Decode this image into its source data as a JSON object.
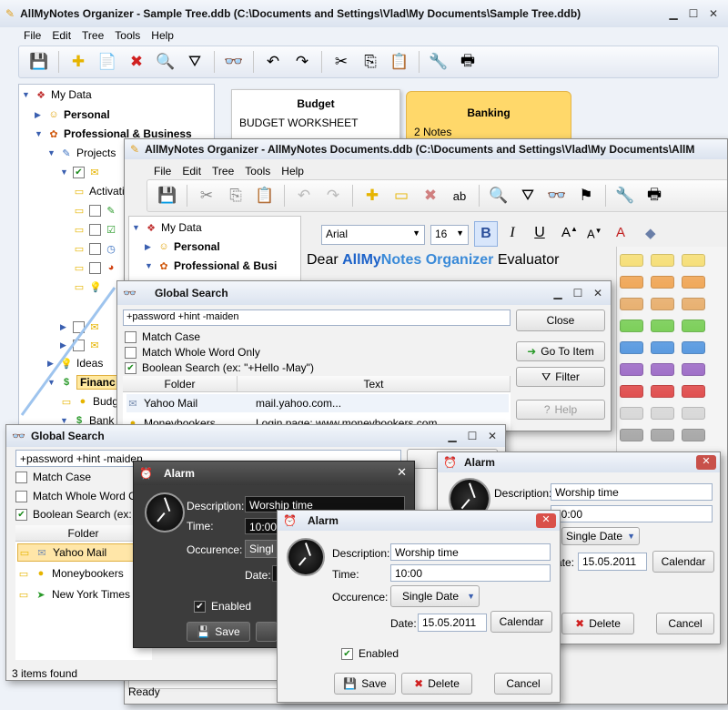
{
  "main": {
    "title": "AllMyNotes Organizer - Sample Tree.ddb (C:\\Documents and Settings\\Vlad\\My Documents\\Sample Tree.ddb)",
    "menu": [
      "File",
      "Edit",
      "Tree",
      "Tools",
      "Help"
    ],
    "tree": {
      "root": "My Data",
      "personal": "Personal",
      "professional": "Professional & Business",
      "projects": "Projects",
      "activation": "Activati",
      "ideas": "Ideas",
      "finance": "Financ",
      "budget": "Budg",
      "bank": "Bank"
    },
    "tabs": {
      "budget_title": "Budget",
      "budget_body": "BUDGET WORKSHEET",
      "banking_title": "Banking",
      "banking_body": "2 Notes"
    }
  },
  "second": {
    "title": "AllMyNotes Organizer - AllMyNotes Documents.ddb (C:\\Documents and Settings\\Vlad\\My Documents\\AllM",
    "menu": [
      "File",
      "Edit",
      "Tree",
      "Tools",
      "Help"
    ],
    "tree": {
      "root": "My Data",
      "personal": "Personal",
      "professional": "Professional & Busi"
    },
    "font": "Arial",
    "size": "16",
    "editor": {
      "part1": "Dear ",
      "part2": "AllMy",
      "part3": "Notes Organizer",
      "part4": " Evaluator"
    },
    "status": "Ready"
  },
  "search1": {
    "title": "Global Search",
    "query": "+password +hint -maiden",
    "match_case": "Match Case",
    "whole_word": "Match Whole Word Only",
    "boolean": "Boolean Search (ex: \"+Hello -May\")",
    "col_folder": "Folder",
    "col_text": "Text",
    "rows": [
      {
        "folder": "Yahoo Mail",
        "text": "mail.yahoo.com..."
      },
      {
        "folder": "Moneybookers",
        "text": "Login page: www.moneybookers.com..."
      }
    ],
    "close": "Close",
    "goto": "Go To Item",
    "filter": "Filter",
    "help": "Help"
  },
  "search2": {
    "title": "Global Search",
    "query": "+password +hint -maiden",
    "match_case": "Match Case",
    "whole_word": "Match Whole Word O",
    "boolean": "Boolean Search (ex: \"",
    "col_folder": "Folder",
    "rows": [
      "Yahoo Mail",
      "Moneybookers",
      "New York Times"
    ],
    "status": "3 items found"
  },
  "alarm_dark": {
    "title": "Alarm",
    "desc_label": "Description:",
    "desc": "Worship time",
    "time_label": "Time:",
    "time": "10:00",
    "occ_label": "Occurence:",
    "occ": "Singl",
    "date_label": "Date:",
    "date": "1",
    "enabled": "Enabled",
    "save": "Save"
  },
  "alarm_right": {
    "title": "Alarm",
    "desc_label": "Description:",
    "desc": "Worship time",
    "time": "10:00",
    "occ": "Single Date",
    "date_label": "ate:",
    "date": "15.05.2011",
    "calendar": "Calendar",
    "delete": "Delete",
    "cancel": "Cancel"
  },
  "alarm_front": {
    "title": "Alarm",
    "desc_label": "Description:",
    "desc": "Worship time",
    "time_label": "Time:",
    "time": "10:00",
    "occ_label": "Occurence:",
    "occ": "Single Date",
    "date_label": "Date:",
    "date": "15.05.2011",
    "calendar": "Calendar",
    "enabled": "Enabled",
    "save": "Save",
    "delete": "Delete",
    "cancel": "Cancel"
  },
  "colors": {
    "accent": "#1c62c9",
    "tab_yellow": "#ffd86a",
    "brand_red": "#d02020"
  }
}
